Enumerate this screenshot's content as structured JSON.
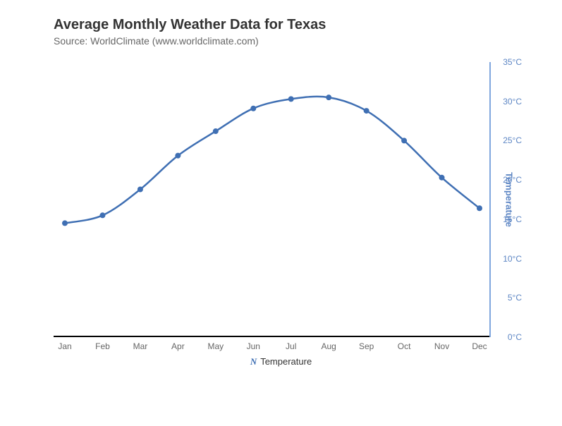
{
  "title": "Average Monthly Weather Data for Texas",
  "subtitle": "Source: WorldClimate (www.worldclimate.com)",
  "y_axis_title": "Temperature",
  "legend": {
    "series_label": "Temperature"
  },
  "x_ticks": [
    "Jan",
    "Feb",
    "Mar",
    "Apr",
    "May",
    "Jun",
    "Jul",
    "Aug",
    "Sep",
    "Oct",
    "Nov",
    "Dec"
  ],
  "y_ticks": [
    "0°C",
    "5°C",
    "10°C",
    "15°C",
    "20°C",
    "25°C",
    "30°C",
    "35°C"
  ],
  "series_color": "#3f6fb3",
  "chart_data": {
    "type": "line",
    "title": "Average Monthly Weather Data for Texas",
    "xlabel": "",
    "ylabel": "Temperature",
    "ylim": [
      0,
      35
    ],
    "categories": [
      "Jan",
      "Feb",
      "Mar",
      "Apr",
      "May",
      "Jun",
      "Jul",
      "Aug",
      "Sep",
      "Oct",
      "Nov",
      "Dec"
    ],
    "series": [
      {
        "name": "Temperature",
        "unit": "°C",
        "values": [
          14.5,
          15.5,
          18.8,
          23.1,
          26.2,
          29.1,
          30.3,
          30.5,
          28.8,
          25.0,
          20.3,
          16.4
        ]
      }
    ]
  }
}
